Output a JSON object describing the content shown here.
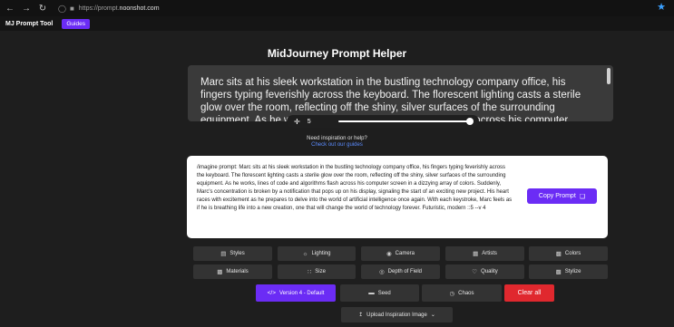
{
  "browser": {
    "back_icon": "arrow-left-icon",
    "forward_icon": "arrow-right-icon",
    "reload_icon": "reload-icon",
    "url_prefix": "https://prompt.",
    "url_host": "noonshot.com"
  },
  "app": {
    "title": "MJ Prompt Tool",
    "tab_guides": "Guides"
  },
  "main": {
    "title": "MidJourney Prompt Helper",
    "prompt_input_value": "Marc sits at his sleek workstation in the bustling technology company office, his fingers typing feverishly across the keyboard. The florescent lighting casts a sterile glow over the room, reflecting off the shiny, silver surfaces of the surrounding equipment. As he works, lines of code and algorithms flash across his computer",
    "slider_value": "5",
    "help_question": "Need inspiration or help?",
    "help_link": "Check out our guides"
  },
  "output": {
    "text": "/imagine prompt: Marc sits at his sleek workstation in the bustling technology company office, his fingers typing feverishly across the keyboard. The florescent lighting casts a sterile glow over the room, reflecting off the shiny, silver surfaces of the surrounding equipment. As he works, lines of code and algorithms flash across his computer screen in a dizzying array of colors. Suddenly, Marc's concentration is broken by a notification that pops up on his display, signaling the start of an exciting new project. His heart races with excitement as he prepares to delve into the world of artificial intelligence once again. With each keystroke, Marc feels as if he is breathing life into a new creation, one that will change the world of technology forever. Futuristic, modern ::5 --v 4",
    "copy_label": "Copy Prompt"
  },
  "modifiers": {
    "styles": "Styles",
    "lighting": "Lighting",
    "camera": "Camera",
    "artists": "Artists",
    "colors": "Colors",
    "materials": "Materials",
    "size": "Size",
    "depth_of_field": "Depth of Field",
    "quality": "Quality",
    "stylize": "Stylize"
  },
  "actions": {
    "version": "Version 4 - Default",
    "seed": "Seed",
    "chaos": "Chaos",
    "clear": "Clear all",
    "upload": "Upload Inspiration Image"
  },
  "colors": {
    "accent": "#6b2cf5",
    "danger": "#e0282e",
    "background": "#1e1e1e",
    "link": "#5b8cff"
  }
}
